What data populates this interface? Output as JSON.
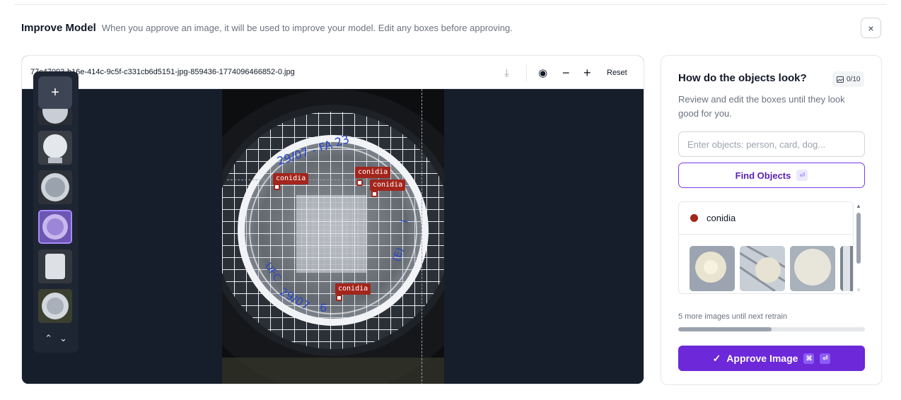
{
  "header": {
    "title": "Improve Model",
    "subtitle": "When you approve an image, it will be used to improve your model. Edit any boxes before approving.",
    "close_icon": "×"
  },
  "viewer": {
    "filename": "77c47093-b16e-414c-9c5f-c331cb6d5151-jpg-859436-1774096466852-0.jpg",
    "reset_label": "Reset",
    "download_icon": "⤓",
    "eye_icon": "◉",
    "minus_icon": "−",
    "plus_icon": "+",
    "detections": [
      {
        "label": "conidia"
      },
      {
        "label": "conidia"
      },
      {
        "label": "conidia"
      },
      {
        "label": "conidia"
      }
    ],
    "thumbnails": {
      "add_icon": "+",
      "count": 7,
      "selected_index": 3,
      "up_icon": "⌃",
      "down_icon": "⌄"
    }
  },
  "panel": {
    "title": "How do the objects look?",
    "badge": "0/10",
    "badge_icon": "image-icon",
    "description": "Review and edit the boxes until they look good for you.",
    "input_placeholder": "Enter objects: person, card, dog...",
    "find_label": "Find Objects",
    "find_kbd": "⏎",
    "class_item": {
      "name": "conidia",
      "color": "#a3251c"
    },
    "retrain_text": "5 more images until next retrain",
    "retrain_progress": 0.5,
    "approve_label": "Approve Image",
    "approve_kbd_1": "⌘",
    "approve_kbd_2": "⏎",
    "check_icon": "✓"
  },
  "colors": {
    "accent": "#6d28d9",
    "label": "#a3251c",
    "canvas": "#161d2b"
  }
}
